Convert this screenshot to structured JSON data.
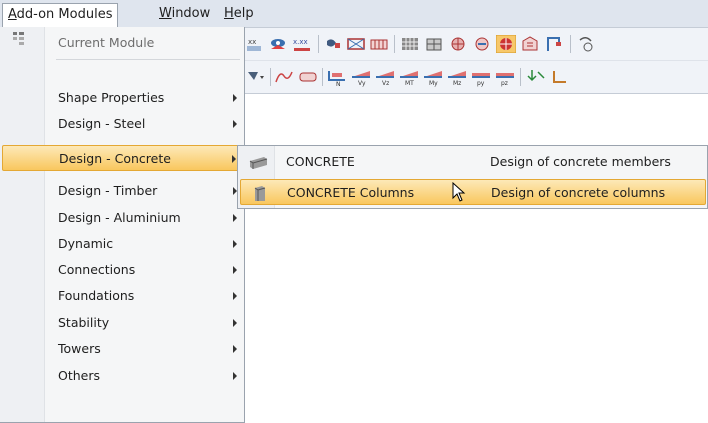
{
  "menubar": {
    "items": [
      {
        "label": "Add-on Modules"
      },
      {
        "label": "Window"
      },
      {
        "label": "Help"
      }
    ]
  },
  "toolbar1": {
    "icon_text": "x.xx"
  },
  "toolbar2": {
    "icon_labels": [
      "N",
      "Vy",
      "Vz",
      "MT",
      "My",
      "Mz",
      "py",
      "pz"
    ]
  },
  "dropdown": {
    "items": [
      {
        "label": "Current Module",
        "disabled": true,
        "has_submenu": false
      },
      {
        "label": "Shape Properties",
        "has_submenu": true
      },
      {
        "label": "Design - Steel",
        "has_submenu": true
      },
      {
        "label": "Design - Concrete",
        "has_submenu": true,
        "highlighted": true
      },
      {
        "label": "Design - Timber",
        "has_submenu": true
      },
      {
        "label": "Design - Aluminium",
        "has_submenu": true
      },
      {
        "label": "Dynamic",
        "has_submenu": true
      },
      {
        "label": "Connections",
        "has_submenu": true
      },
      {
        "label": "Foundations",
        "has_submenu": true
      },
      {
        "label": "Stability",
        "has_submenu": true
      },
      {
        "label": "Towers",
        "has_submenu": true
      },
      {
        "label": "Others",
        "has_submenu": true
      }
    ]
  },
  "submenu": {
    "items": [
      {
        "name": "CONCRETE",
        "description": "Design of concrete members",
        "icon": "concrete-beam-icon"
      },
      {
        "name": "CONCRETE Columns",
        "description": "Design of concrete columns",
        "icon": "concrete-column-icon",
        "highlighted": true
      }
    ]
  },
  "colors": {
    "highlight_top": "#fde9b8",
    "highlight_bottom": "#f9c75e",
    "highlight_border": "#e4a834",
    "menubar_bg": "#dfe5ee"
  }
}
